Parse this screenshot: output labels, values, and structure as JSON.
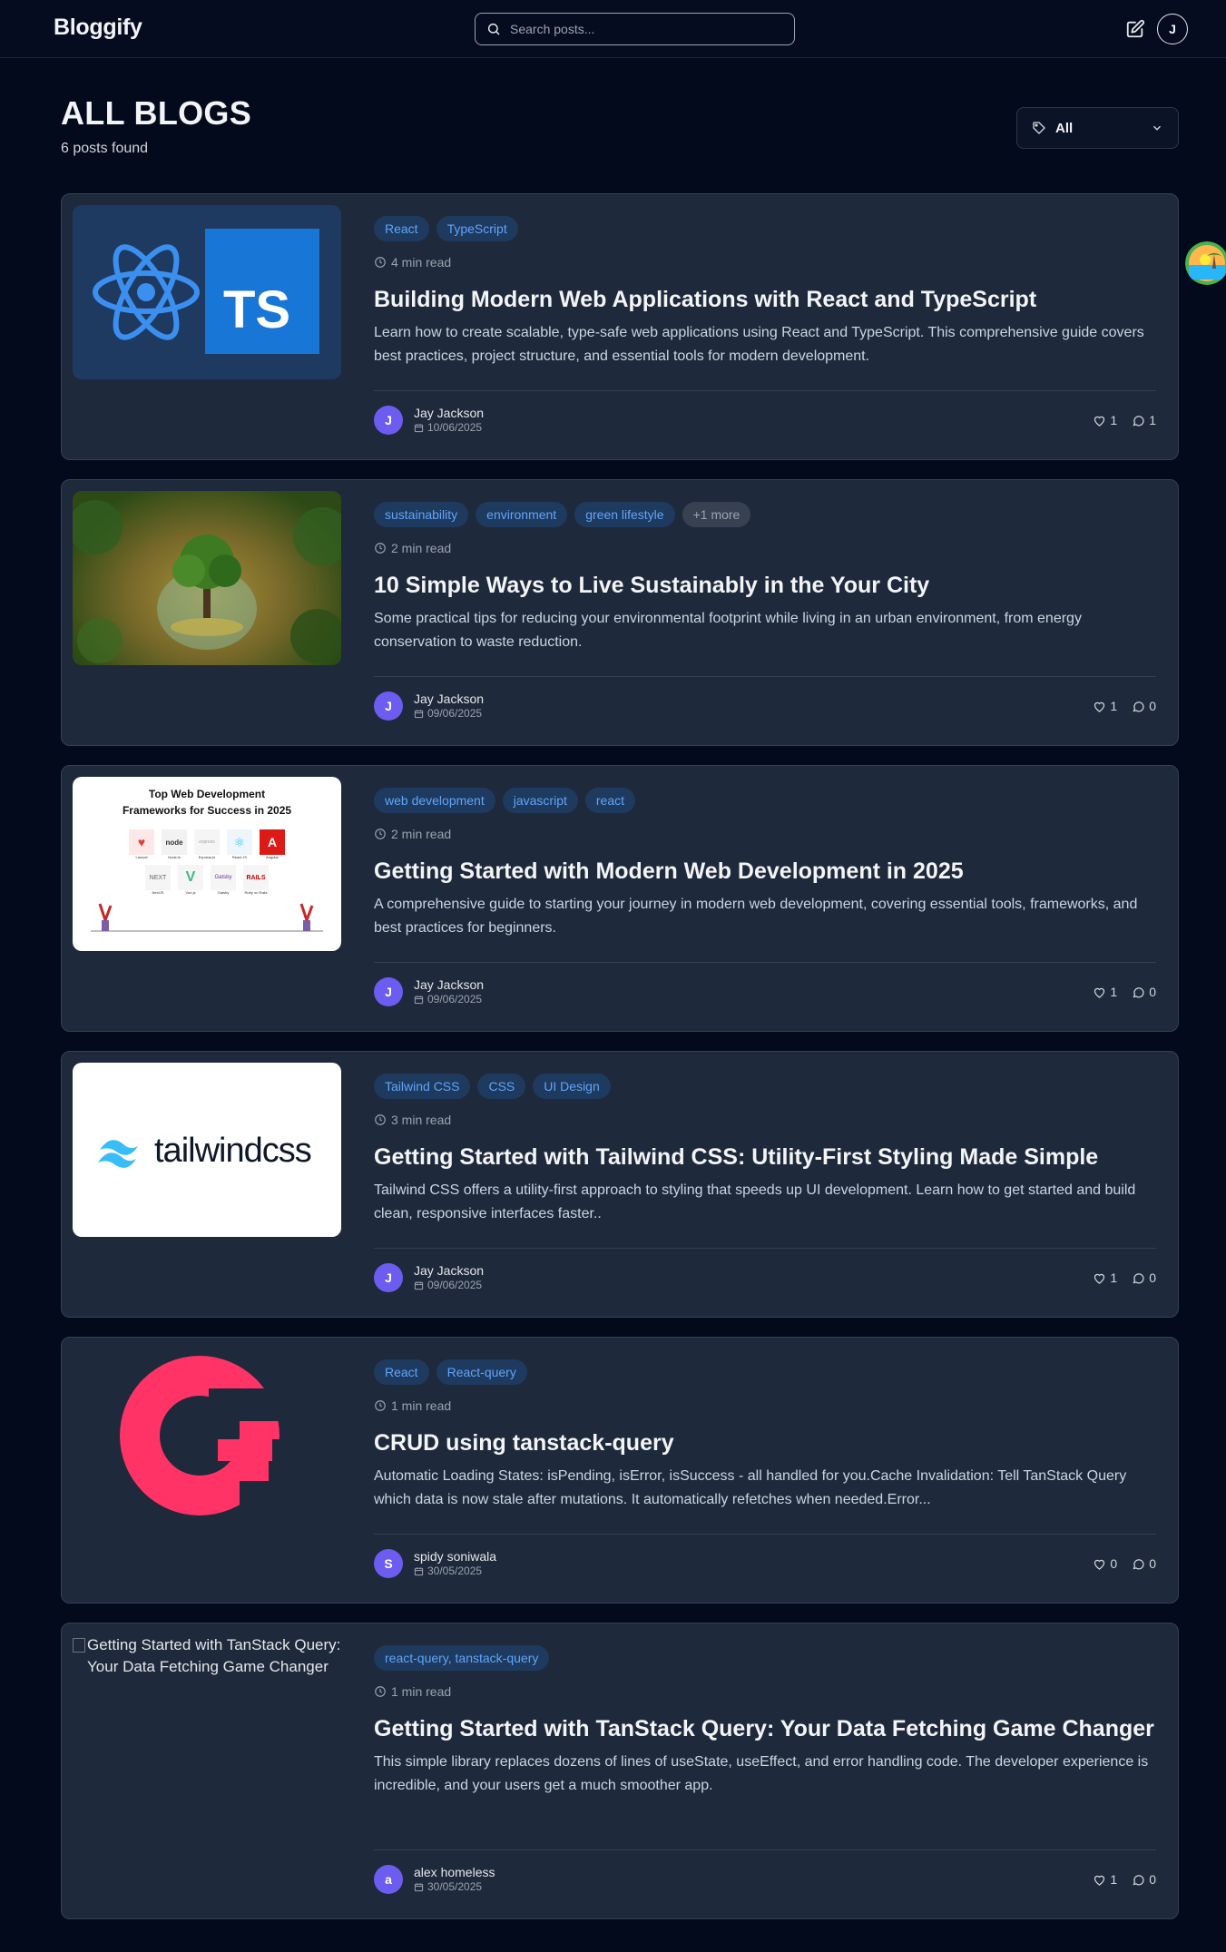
{
  "header": {
    "brand": "Bloggify",
    "search_placeholder": "Search posts...",
    "user_initial": "J"
  },
  "page": {
    "title": "ALL BLOGS",
    "count": "6 posts found",
    "filter_label": "All"
  },
  "posts": [
    {
      "tags": [
        "React",
        "TypeScript"
      ],
      "read_time": "4 min read",
      "title": "Building Modern Web Applications with React and TypeScript",
      "excerpt": "Learn how to create scalable, type-safe web applications using React and TypeScript. This comprehensive guide covers best practices, project structure, and essential tools for modern development.",
      "author": "Jay Jackson",
      "author_initial": "J",
      "date": "10/06/2025",
      "likes": "1",
      "comments": "1",
      "image_label": "TS"
    },
    {
      "tags": [
        "sustainability",
        "environment",
        "green lifestyle",
        "+1 more"
      ],
      "read_time": "2 min read",
      "title": "10 Simple Ways to Live Sustainably in the Your City",
      "excerpt": "Some practical tips for reducing your environmental footprint while living in an urban environment, from energy conservation to waste reduction.",
      "author": "Jay Jackson",
      "author_initial": "J",
      "date": "09/06/2025",
      "likes": "1",
      "comments": "0"
    },
    {
      "tags": [
        "web development",
        "javascript",
        "react"
      ],
      "read_time": "2 min read",
      "title": "Getting Started with Modern Web Development in 2025",
      "excerpt": "A comprehensive guide to starting your journey in modern web development, covering essential tools, frameworks, and best practices for beginners.",
      "author": "Jay Jackson",
      "author_initial": "J",
      "date": "09/06/2025",
      "likes": "1",
      "comments": "0",
      "image_title": "Top Web Development Frameworks for Success in 2025",
      "image_frameworks": [
        "Laravel",
        "NodeJs",
        "ExpressJs",
        "React JS",
        "Angular",
        "NextJS",
        "Vue.js",
        "Gatsby",
        "Ruby on Rails"
      ]
    },
    {
      "tags": [
        "Tailwind CSS",
        "CSS",
        "UI Design"
      ],
      "read_time": "3 min read",
      "title": "Getting Started with Tailwind CSS: Utility-First Styling Made Simple",
      "excerpt": "Tailwind CSS offers a utility-first approach to styling that speeds up UI development. Learn how to get started and build clean, responsive interfaces faster..",
      "author": "Jay Jackson",
      "author_initial": "J",
      "date": "09/06/2025",
      "likes": "1",
      "comments": "0",
      "image_label": "tailwindcss"
    },
    {
      "tags": [
        "React",
        "React-query"
      ],
      "read_time": "1 min read",
      "title": "CRUD using tanstack-query",
      "excerpt": "Automatic Loading States: isPending, isError, isSuccess - all handled for you.Cache Invalidation: Tell TanStack Query which data is now stale after mutations. It automatically refetches when needed.Error...",
      "author": "spidy soniwala",
      "author_initial": "S",
      "date": "30/05/2025",
      "likes": "0",
      "comments": "0"
    },
    {
      "tags": [
        "react-query, tanstack-query"
      ],
      "read_time": "1 min read",
      "title": "Getting Started with TanStack Query: Your Data Fetching Game Changer",
      "excerpt": "This simple library replaces dozens of lines of useState, useEffect, and error handling code. The developer experience is incredible, and your users get a much smoother app.",
      "author": "alex homeless",
      "author_initial": "a",
      "date": "30/05/2025",
      "likes": "1",
      "comments": "0",
      "image_alt": "Getting Started with TanStack Query: Your Data Fetching Game Changer"
    }
  ],
  "colors": {
    "background": "#030a1c",
    "card": "#1e293b",
    "tag_bg": "#1e3a5f",
    "tag_text": "#60a5fa",
    "avatar": "#6d5cf0",
    "tanstack_red": "#ff3366"
  }
}
